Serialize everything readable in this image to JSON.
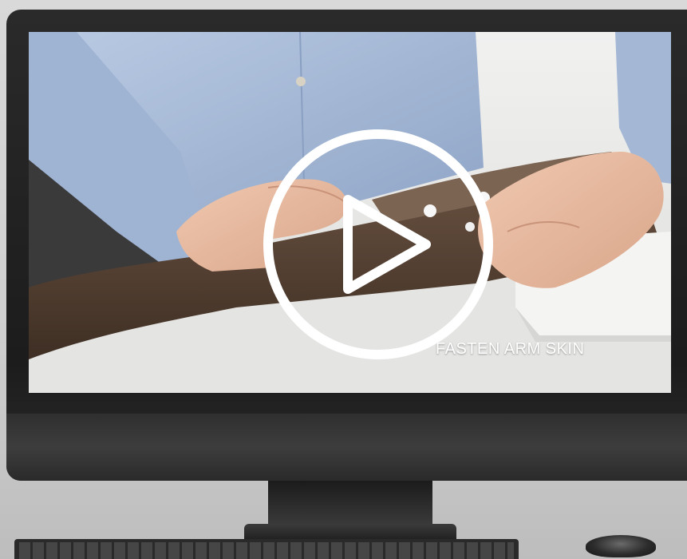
{
  "video": {
    "caption": "FASTEN ARM SKIN",
    "play_icon": "play-circle-icon"
  },
  "colors": {
    "shirt": "#a9bcd8",
    "arm_skin": "#5a4536",
    "table": "#e6e6e4",
    "bezel": "#1e1e1e",
    "play_icon": "#ffffff"
  }
}
